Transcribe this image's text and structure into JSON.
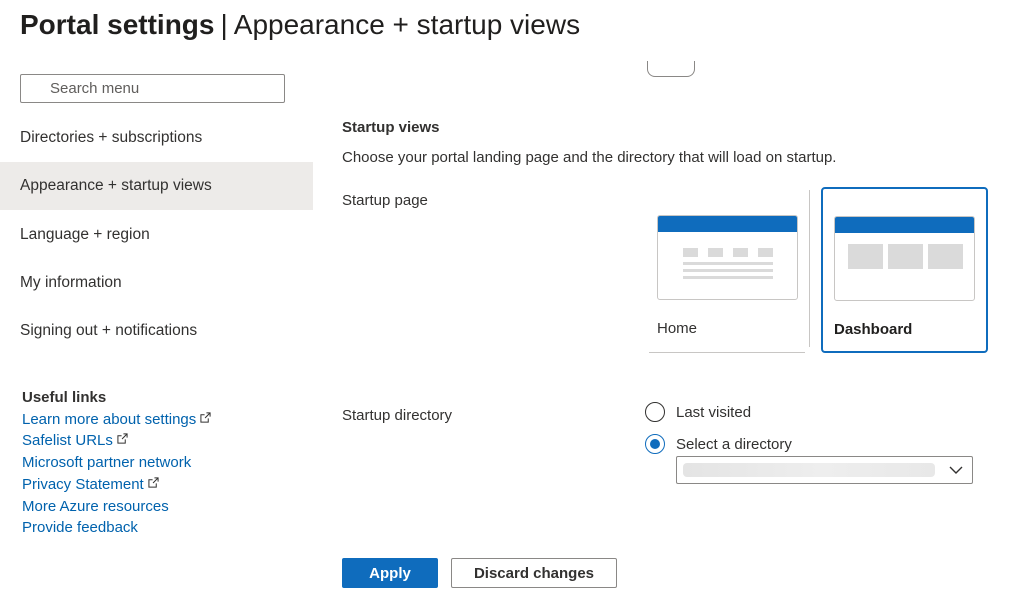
{
  "header": {
    "title_bold": "Portal settings",
    "title_separator": "|",
    "title_rest": "Appearance + startup views"
  },
  "sidebar": {
    "search_placeholder": "Search menu",
    "items": [
      {
        "label": "Directories + subscriptions",
        "selected": false
      },
      {
        "label": "Appearance + startup views",
        "selected": true
      },
      {
        "label": "Language + region",
        "selected": false
      },
      {
        "label": "My information",
        "selected": false
      },
      {
        "label": "Signing out + notifications",
        "selected": false
      }
    ],
    "useful_links": {
      "title": "Useful links",
      "links": [
        {
          "label": "Learn more about settings",
          "external": true
        },
        {
          "label": "Safelist URLs",
          "external": true
        },
        {
          "label": "Microsoft partner network",
          "external": false
        },
        {
          "label": "Privacy Statement",
          "external": true
        },
        {
          "label": "More Azure resources",
          "external": false
        },
        {
          "label": "Provide feedback",
          "external": false
        }
      ]
    }
  },
  "main": {
    "startup_views": {
      "title": "Startup views",
      "description": "Choose your portal landing page and the directory that will load on startup.",
      "startup_page_label": "Startup page",
      "options": [
        {
          "label": "Home",
          "selected": false,
          "icon": "home-layout-thumbnail"
        },
        {
          "label": "Dashboard",
          "selected": true,
          "icon": "dashboard-layout-thumbnail"
        }
      ],
      "startup_directory_label": "Startup directory",
      "directory_options": [
        {
          "label": "Last visited",
          "checked": false
        },
        {
          "label": "Select a directory",
          "checked": true
        }
      ],
      "directory_value": ""
    },
    "actions": {
      "apply_label": "Apply",
      "discard_label": "Discard changes"
    }
  },
  "colors": {
    "accent": "#0f6cbd",
    "link": "#0062ad",
    "selected_bg": "#edebe9",
    "text": "#323130"
  }
}
